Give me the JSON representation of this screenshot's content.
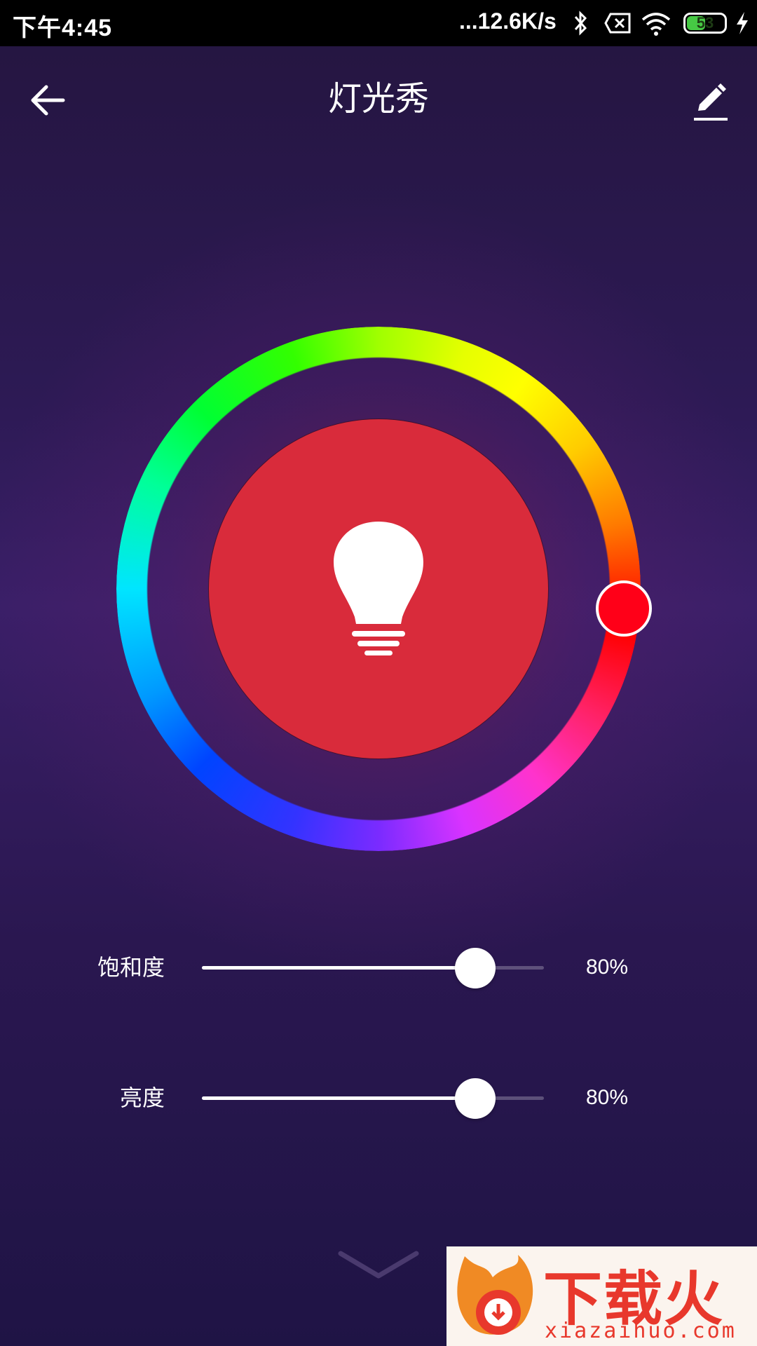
{
  "status_bar": {
    "time": "下午4:45",
    "net_speed": "...12.6K/s",
    "battery_level": "53",
    "battery_fraction": 0.53
  },
  "header": {
    "title": "灯光秀",
    "back_icon": "arrow-left-icon",
    "edit_icon": "pencil-icon"
  },
  "color_wheel": {
    "selected_color": "#ff0018",
    "center_color": "#d92b3b",
    "center_icon": "light-bulb-icon"
  },
  "sliders": [
    {
      "label": "饱和度",
      "value_text": "80%",
      "fraction": 0.8
    },
    {
      "label": "亮度",
      "value_text": "80%",
      "fraction": 0.8
    }
  ],
  "footer": {
    "expand_icon": "chevron-down-icon"
  },
  "watermark": {
    "brand": "下载火",
    "url": "xiazaihuo.com"
  }
}
